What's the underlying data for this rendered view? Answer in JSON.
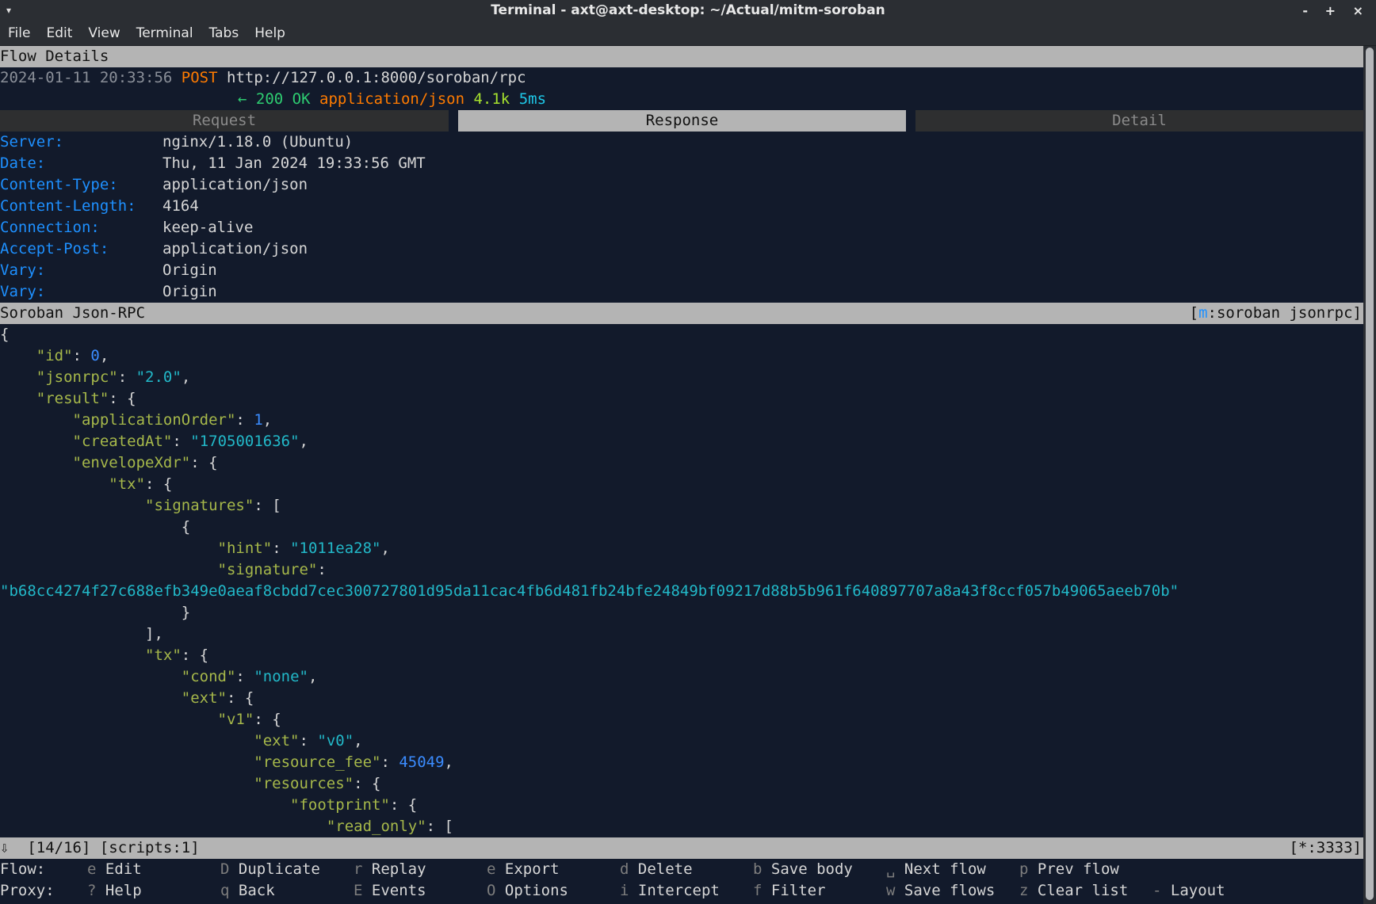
{
  "window": {
    "title": "Terminal - axt@axt-desktop: ~/Actual/mitm-soroban",
    "controls": "- + ×"
  },
  "menu": [
    "File",
    "Edit",
    "View",
    "Terminal",
    "Tabs",
    "Help"
  ],
  "flow": {
    "section_title": "Flow Details",
    "timestamp": "2024-01-11 20:33:56",
    "method": "POST",
    "url": "http://127.0.0.1:8000/soroban/rpc",
    "arrow": "←",
    "status": "200 OK",
    "content_type": "application/json",
    "size": "4.1k",
    "time": "5ms"
  },
  "tabs": [
    {
      "label": "Request"
    },
    {
      "label": "Response"
    },
    {
      "label": "Detail"
    }
  ],
  "headers": [
    {
      "key": "Server:",
      "value": "nginx/1.18.0 (Ubuntu)"
    },
    {
      "key": "Date:",
      "value": "Thu, 11 Jan 2024 19:33:56 GMT"
    },
    {
      "key": "Content-Type:",
      "value": "application/json"
    },
    {
      "key": "Content-Length:",
      "value": "4164"
    },
    {
      "key": "Connection:",
      "value": "keep-alive"
    },
    {
      "key": "Accept-Post:",
      "value": "application/json"
    },
    {
      "key": "Vary:",
      "value": "Origin"
    },
    {
      "key": "Vary:",
      "value": "Origin"
    }
  ],
  "view": {
    "title": "Soroban Json-RPC",
    "mode_open": "[",
    "mode_key": "m",
    "mode_rest": ":soroban jsonrpc]"
  },
  "json_lines": [
    [
      {
        "t": "p",
        "v": "{"
      }
    ],
    [
      {
        "t": "p",
        "v": "    "
      },
      {
        "t": "k",
        "v": "\"id\""
      },
      {
        "t": "p",
        "v": ": "
      },
      {
        "t": "n",
        "v": "0"
      },
      {
        "t": "p",
        "v": ","
      }
    ],
    [
      {
        "t": "p",
        "v": "    "
      },
      {
        "t": "k",
        "v": "\"jsonrpc\""
      },
      {
        "t": "p",
        "v": ": "
      },
      {
        "t": "s",
        "v": "\"2.0\""
      },
      {
        "t": "p",
        "v": ","
      }
    ],
    [
      {
        "t": "p",
        "v": "    "
      },
      {
        "t": "k",
        "v": "\"result\""
      },
      {
        "t": "p",
        "v": ": {"
      }
    ],
    [
      {
        "t": "p",
        "v": "        "
      },
      {
        "t": "k",
        "v": "\"applicationOrder\""
      },
      {
        "t": "p",
        "v": ": "
      },
      {
        "t": "n",
        "v": "1"
      },
      {
        "t": "p",
        "v": ","
      }
    ],
    [
      {
        "t": "p",
        "v": "        "
      },
      {
        "t": "k",
        "v": "\"createdAt\""
      },
      {
        "t": "p",
        "v": ": "
      },
      {
        "t": "s",
        "v": "\"1705001636\""
      },
      {
        "t": "p",
        "v": ","
      }
    ],
    [
      {
        "t": "p",
        "v": "        "
      },
      {
        "t": "k",
        "v": "\"envelopeXdr\""
      },
      {
        "t": "p",
        "v": ": {"
      }
    ],
    [
      {
        "t": "p",
        "v": "            "
      },
      {
        "t": "k",
        "v": "\"tx\""
      },
      {
        "t": "p",
        "v": ": {"
      }
    ],
    [
      {
        "t": "p",
        "v": "                "
      },
      {
        "t": "k",
        "v": "\"signatures\""
      },
      {
        "t": "p",
        "v": ": ["
      }
    ],
    [
      {
        "t": "p",
        "v": "                    {"
      }
    ],
    [
      {
        "t": "p",
        "v": "                        "
      },
      {
        "t": "k",
        "v": "\"hint\""
      },
      {
        "t": "p",
        "v": ": "
      },
      {
        "t": "s",
        "v": "\"1011ea28\""
      },
      {
        "t": "p",
        "v": ","
      }
    ],
    [
      {
        "t": "p",
        "v": "                        "
      },
      {
        "t": "k",
        "v": "\"signature\""
      },
      {
        "t": "p",
        "v": ":"
      }
    ],
    [
      {
        "t": "s",
        "v": "\"b68cc4274f27c688efb349e0aeaf8cbdd7cec300727801d95da11cac4fb6d481fb24bfe24849bf09217d88b5b961f640897707a8a43f8ccf057b49065aeeb70b\""
      }
    ],
    [
      {
        "t": "p",
        "v": "                    }"
      }
    ],
    [
      {
        "t": "p",
        "v": "                ],"
      }
    ],
    [
      {
        "t": "p",
        "v": "                "
      },
      {
        "t": "k",
        "v": "\"tx\""
      },
      {
        "t": "p",
        "v": ": {"
      }
    ],
    [
      {
        "t": "p",
        "v": "                    "
      },
      {
        "t": "k",
        "v": "\"cond\""
      },
      {
        "t": "p",
        "v": ": "
      },
      {
        "t": "s",
        "v": "\"none\""
      },
      {
        "t": "p",
        "v": ","
      }
    ],
    [
      {
        "t": "p",
        "v": "                    "
      },
      {
        "t": "k",
        "v": "\"ext\""
      },
      {
        "t": "p",
        "v": ": {"
      }
    ],
    [
      {
        "t": "p",
        "v": "                        "
      },
      {
        "t": "k",
        "v": "\"v1\""
      },
      {
        "t": "p",
        "v": ": {"
      }
    ],
    [
      {
        "t": "p",
        "v": "                            "
      },
      {
        "t": "k",
        "v": "\"ext\""
      },
      {
        "t": "p",
        "v": ": "
      },
      {
        "t": "s",
        "v": "\"v0\""
      },
      {
        "t": "p",
        "v": ","
      }
    ],
    [
      {
        "t": "p",
        "v": "                            "
      },
      {
        "t": "k",
        "v": "\"resource_fee\""
      },
      {
        "t": "p",
        "v": ": "
      },
      {
        "t": "n",
        "v": "45049"
      },
      {
        "t": "p",
        "v": ","
      }
    ],
    [
      {
        "t": "p",
        "v": "                            "
      },
      {
        "t": "k",
        "v": "\"resources\""
      },
      {
        "t": "p",
        "v": ": {"
      }
    ],
    [
      {
        "t": "p",
        "v": "                                "
      },
      {
        "t": "k",
        "v": "\"footprint\""
      },
      {
        "t": "p",
        "v": ": {"
      }
    ],
    [
      {
        "t": "p",
        "v": "                                    "
      },
      {
        "t": "k",
        "v": "\"read_only\""
      },
      {
        "t": "p",
        "v": ": ["
      }
    ]
  ],
  "status": {
    "left": "⇩  [14/16] [scripts:1]",
    "right": "[*:3333]"
  },
  "footer": {
    "rows": [
      {
        "label": "Flow:",
        "items": [
          {
            "key": "e",
            "label": "Edit"
          },
          {
            "key": "D",
            "label": "Duplicate"
          },
          {
            "key": "r",
            "label": "Replay"
          },
          {
            "key": "e",
            "label": "Export"
          },
          {
            "key": "d",
            "label": "Delete"
          },
          {
            "key": "b",
            "label": "Save body"
          },
          {
            "key": "␣",
            "label": "Next flow"
          },
          {
            "key": "p",
            "label": "Prev flow"
          }
        ]
      },
      {
        "label": "Proxy:",
        "items": [
          {
            "key": "?",
            "label": "Help"
          },
          {
            "key": "q",
            "label": "Back"
          },
          {
            "key": "E",
            "label": "Events"
          },
          {
            "key": "O",
            "label": "Options"
          },
          {
            "key": "i",
            "label": "Intercept"
          },
          {
            "key": "f",
            "label": "Filter"
          },
          {
            "key": "w",
            "label": "Save flows"
          },
          {
            "key": "z",
            "label": "Clear list"
          },
          {
            "key": "-",
            "label": "Layout"
          }
        ]
      }
    ]
  }
}
